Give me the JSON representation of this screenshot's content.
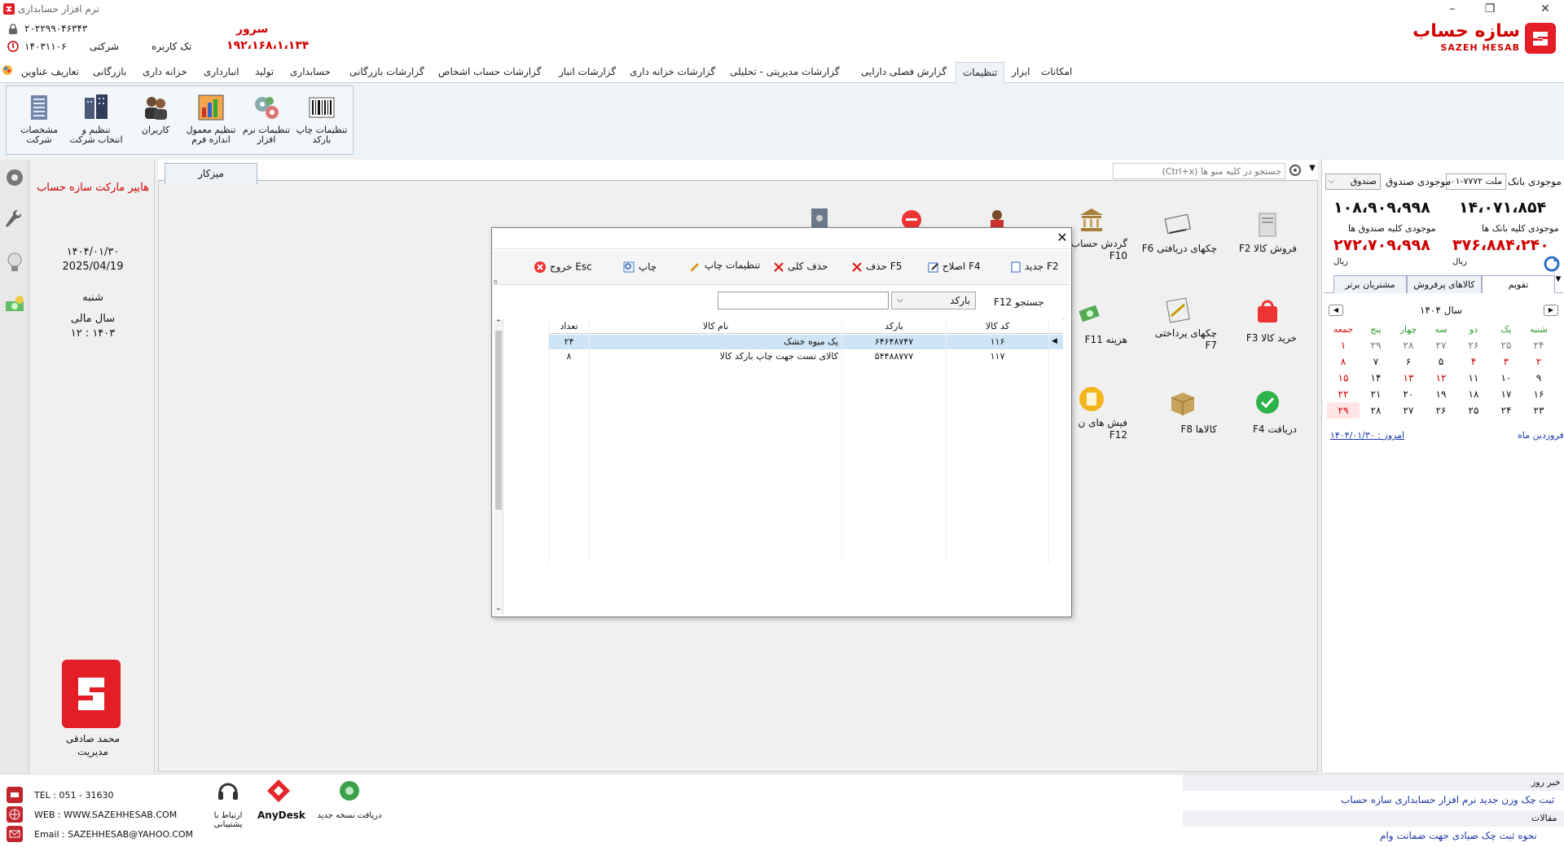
{
  "window": {
    "title": "نرم افزار حسابداری",
    "controls": [
      "–",
      "❐",
      "✕"
    ]
  },
  "info_bar": {
    "phone_id": "۲۰۲۲۹۹۰۴۶۳۴۳",
    "date_code": "۱۴۰۳۱۱۰۶",
    "company_type": "شرکتی",
    "user_mode": "تک کاربره",
    "server_label": "سرور",
    "server_ip": "۱۹۲،۱۶۸،۱،۱۳۴",
    "logo_text": "سازه حساب",
    "logo_sub": "SAZEH HESAB"
  },
  "ribbon_tabs": [
    "امکانات",
    "ابزار",
    "تنظیمات",
    "گزارش فصلی دارایی",
    "گزارشات مدیریتی - تحلیلی",
    "گزارشات خزانه داری",
    "گزارشات انبار",
    "گزارشات حساب اشخاص",
    "گزارشات بازرگانی",
    "حسابداری",
    "تولید",
    "انبارداری",
    "خزانه داری",
    "بازرگانی",
    "تعاریف عناوین"
  ],
  "ribbon_active": "تنظیمات",
  "ribbon_buttons": [
    {
      "label": "تنظیمات چاپ بارکد",
      "icon": "barcode-icon"
    },
    {
      "label": "تنظیمات نرم افزار",
      "icon": "settings-gears-icon"
    },
    {
      "label": "تنظیم معمول اندازه فرم",
      "icon": "form-size-icon"
    },
    {
      "label": "کاربران",
      "icon": "users-icon"
    },
    {
      "label": "تنظیم و انتخاب شرکت",
      "icon": "company-select-icon"
    },
    {
      "label": "مشخصات شرکت",
      "icon": "company-info-icon"
    }
  ],
  "left_info": {
    "company_name": "هایپر مارکت سازه حساب",
    "date_fa": "۱۴۰۴/۰۱/۳۰",
    "date_en": "2025/04/19",
    "weekday": "شنبه",
    "fiscal_label": "سال مالی",
    "fiscal_value": "۱۲ : ۱۴۰۳",
    "user_name": "محمد صادقی",
    "user_role": "مدیریت"
  },
  "main": {
    "tab_label": "میزکار",
    "search_placeholder": "(Ctrl+x) جستجو در کلیه منو ها",
    "shortcuts": [
      {
        "label": "F2  فروش کالا",
        "icon": "sale-icon"
      },
      {
        "label": "F6  چکهای دریافتی",
        "icon": "received-check-icon"
      },
      {
        "label": "گردش حساب F10",
        "icon": "bank-account-icon"
      },
      {
        "label": "F3  خرید کالا",
        "icon": "purchase-icon"
      },
      {
        "label": "چکهای پرداختی F7",
        "icon": "paid-check-icon"
      },
      {
        "label": "F11  هزینه",
        "icon": "expense-icon"
      },
      {
        "label": "F4  دریافت",
        "icon": "receive-icon"
      },
      {
        "label": "F8  کالاها",
        "icon": "goods-icon"
      },
      {
        "label": "فیش های ن F12",
        "icon": "receipt-icon"
      }
    ]
  },
  "dialog": {
    "toolbar": [
      {
        "label": "جدید F2",
        "icon": "new-doc-icon"
      },
      {
        "label": "اصلاح F4",
        "icon": "edit-icon"
      },
      {
        "label": "حذف F5",
        "icon": "delete-icon"
      },
      {
        "label": "حذف کلی",
        "icon": "delete-all-icon"
      },
      {
        "label": "تنظیمات چاپ",
        "icon": "print-settings-icon"
      },
      {
        "label": "چاپ",
        "icon": "print-icon"
      },
      {
        "label": "خروج Esc",
        "icon": "exit-icon"
      }
    ],
    "search_label": "F12 جستجو",
    "search_field_value": "بارکد",
    "search_input_value": "",
    "columns": [
      "کد کالا",
      "بارکد",
      "نام کالا",
      "تعداد"
    ],
    "rows": [
      [
        "۱۱۶",
        "۶۴۶۴۸۷۴۷",
        "پک میوه خشک",
        "۲۴"
      ],
      [
        "۱۱۷",
        "۵۴۴۸۸۷۷۷",
        "کالای تست جهت چاپ بارکد کالا",
        "۸"
      ]
    ]
  },
  "right_panel": {
    "bank_balance_label": "موجودی بانک",
    "bank_select": "ملت ۷۷۷۲-۱",
    "cash_balance_label": "موجودی صندوق",
    "cash_select": "صندوق",
    "bank_balance_value": "۱۴،۰۷۱،۸۵۴",
    "cash_balance_value": "۱۰۸،۹۰۹،۹۹۸",
    "all_banks_label": "موجودی کلیه بانک ها",
    "all_cash_label": "موجودی کلیه صندوق ها",
    "all_banks_value": "۳۷۶،۸۸۴،۲۴۰",
    "all_cash_value": "۲۷۲،۷۰۹،۹۹۸",
    "currency": "ریال",
    "tabs": [
      "تقویم",
      "کالاهای پرفروش",
      "مشتریان برتر"
    ],
    "calendar_title": "سال ۱۴۰۴",
    "weekdays": [
      "شنبه",
      "یک",
      "دو",
      "سه",
      "چهار",
      "پنج",
      "جمعه"
    ],
    "weeks": [
      [
        "۲۴",
        "۲۵",
        "۲۶",
        "۲۷",
        "۲۸",
        "۲۹",
        "۱"
      ],
      [
        "۲",
        "۳",
        "۴",
        "۵",
        "۶",
        "۷",
        "۸"
      ],
      [
        "۹",
        "۱۰",
        "۱۱",
        "۱۲",
        "۱۳",
        "۱۴",
        "۱۵"
      ],
      [
        "۱۶",
        "۱۷",
        "۱۸",
        "۱۹",
        "۲۰",
        "۲۱",
        "۲۲"
      ],
      [
        "۲۳",
        "۲۴",
        "۲۵",
        "۲۶",
        "۲۷",
        "۲۸",
        "۲۹"
      ]
    ],
    "month_name": "فروردین ماه",
    "today_label": "امروز : ۱۴۰۴/۰۱/۳۰"
  },
  "footer": {
    "tel": "TEL : 051 - 31630",
    "web": "WEB : WWW.SAZEHHESAB.COM",
    "email": "Email : SAZEHHESAB@YAHOO.COM",
    "support_label": "ارتباط با پشتیبانی",
    "anydesk_label": "AnyDesk",
    "update_label": "دریافت نسخه جدید",
    "news_header": "خبر روز",
    "news_text": "ثبت چک وزن جدید نرم افزار حسابداری سازه حساب",
    "articles_header": "مقالات",
    "articles_text": "نحوه ثبت چک صیادی جهت ضمانت وام"
  }
}
